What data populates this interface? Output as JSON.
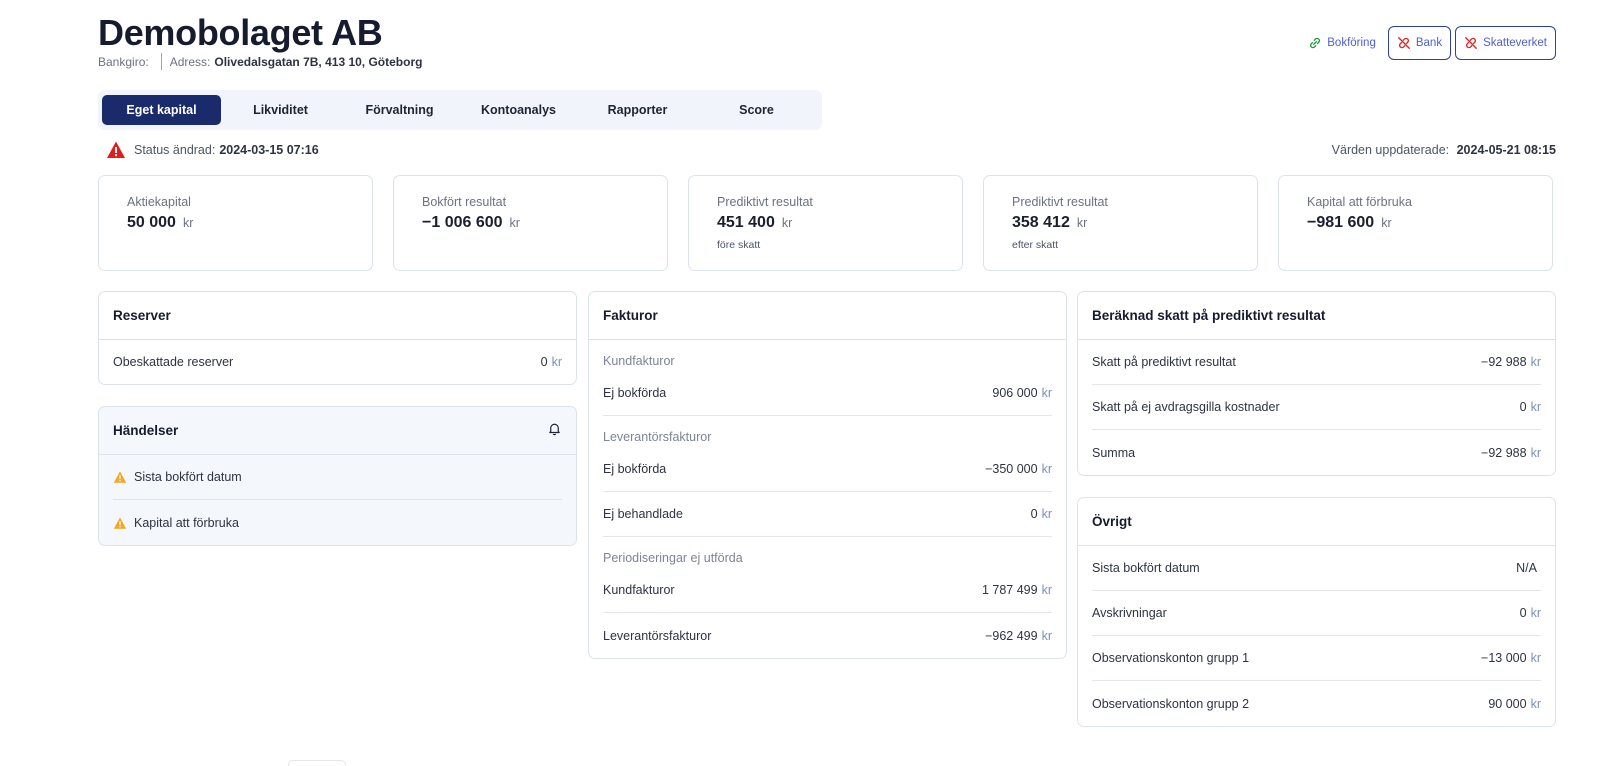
{
  "company": {
    "name": "Demobolaget AB",
    "bankgiro_label": "Bankgiro:",
    "bankgiro_value": "",
    "address_label": "Adress:",
    "address_value": "Olivedalsgatan 7B, 413 10, Göteborg"
  },
  "integrations": [
    {
      "label": "Bokföring",
      "icon": "link-icon",
      "status": "connected",
      "color": "#1f9d3a"
    },
    {
      "label": "Bank",
      "icon": "broken-link-icon",
      "status": "disconnected",
      "color": "#e02424"
    },
    {
      "label": "Skatteverket",
      "icon": "broken-link-icon",
      "status": "disconnected",
      "color": "#e02424"
    }
  ],
  "tabs": [
    {
      "label": "Eget kapital",
      "active": true
    },
    {
      "label": "Likviditet"
    },
    {
      "label": "Förvaltning"
    },
    {
      "label": "Kontoanalys"
    },
    {
      "label": "Rapporter"
    },
    {
      "label": "Score"
    }
  ],
  "status": {
    "icon": "warning-icon",
    "label": "Status ändrad:",
    "value": "2024-03-15 07:16"
  },
  "updated": {
    "label": "Värden uppdaterade:",
    "value": "2024-05-21 08:15"
  },
  "kpis": [
    {
      "label": "Aktiekapital",
      "value": "50 000",
      "unit": "kr",
      "note": ""
    },
    {
      "label": "Bokfört resultat",
      "value": "−1 006 600",
      "unit": "kr",
      "note": ""
    },
    {
      "label": "Prediktivt resultat",
      "value": "451 400",
      "unit": "kr",
      "note": "före skatt"
    },
    {
      "label": "Prediktivt resultat",
      "value": "358 412",
      "unit": "kr",
      "note": "efter skatt"
    },
    {
      "label": "Kapital att förbruka",
      "value": "−981 600",
      "unit": "kr",
      "note": ""
    }
  ],
  "reserver": {
    "title": "Reserver",
    "rows": [
      {
        "label": "Obeskattade reserver",
        "value": "0",
        "unit": "kr"
      }
    ]
  },
  "handelser": {
    "title": "Händelser",
    "icon": "bell-icon",
    "items": [
      {
        "label": "Sista bokfört datum",
        "icon": "warning-icon"
      },
      {
        "label": "Kapital att förbruka",
        "icon": "warning-icon"
      }
    ]
  },
  "fakturor": {
    "title": "Fakturor",
    "sections": [
      {
        "label": "Kundfakturor",
        "rows": [
          {
            "label": "Ej bokförda",
            "value": "906 000",
            "unit": "kr"
          }
        ]
      },
      {
        "label": "Leverantörsfakturor",
        "rows": [
          {
            "label": "Ej bokförda",
            "value": "−350 000",
            "unit": "kr"
          },
          {
            "label": "Ej behandlade",
            "value": "0",
            "unit": "kr"
          }
        ]
      },
      {
        "label": "Periodiseringar ej utförda",
        "rows": [
          {
            "label": "Kundfakturor",
            "value": "1 787 499",
            "unit": "kr"
          },
          {
            "label": "Leverantörsfakturor",
            "value": "−962 499",
            "unit": "kr"
          }
        ]
      }
    ]
  },
  "skatt": {
    "title": "Beräknad skatt på prediktivt resultat",
    "rows": [
      {
        "label": "Skatt på prediktivt resultat",
        "value": "−92 988",
        "unit": "kr"
      },
      {
        "label": "Skatt på ej avdragsgilla kostnader",
        "value": "0",
        "unit": "kr"
      },
      {
        "label": "Summa",
        "value": "−92 988",
        "unit": "kr"
      }
    ]
  },
  "ovrigt": {
    "title": "Övrigt",
    "rows": [
      {
        "label": "Sista bokfört datum",
        "value": "N/A",
        "unit": ""
      },
      {
        "label": "Avskrivningar",
        "value": "0",
        "unit": "kr"
      },
      {
        "label": "Observationskonton grupp 1",
        "value": "−13 000",
        "unit": "kr"
      },
      {
        "label": "Observationskonton grupp 2",
        "value": "90 000",
        "unit": "kr"
      }
    ]
  }
}
